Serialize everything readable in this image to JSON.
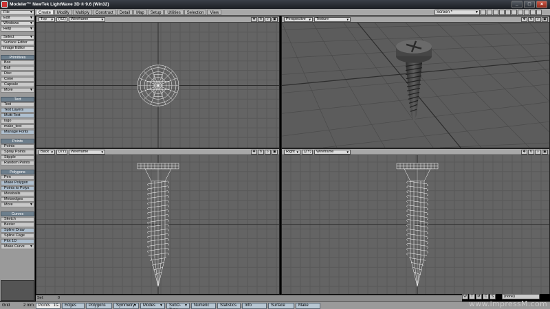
{
  "window": {
    "title": "Modeler™ NewTek LightWave 3D ® 9.6  (Win32)",
    "buttons": [
      "_",
      "□",
      "×"
    ]
  },
  "tabs": [
    "Create",
    "Modify",
    "Multiply",
    "Construct",
    "Detail",
    "Map",
    "Setup",
    "Utilities",
    "Selection",
    "View"
  ],
  "active_tab": "Create",
  "screen_select": "Screen *",
  "sidebar": {
    "menus": [
      "File",
      "Edit",
      "Windows",
      "Help",
      "Select",
      "Surface Editor",
      "Image Editor"
    ],
    "sections": [
      {
        "header": "Primitives",
        "items": [
          "Box",
          "Ball",
          "Disc",
          "Cone",
          "Capsule",
          "More"
        ]
      },
      {
        "header": "Text",
        "items": [
          "Text",
          "Text Layers",
          "Multi-Text",
          "logo",
          "make_text",
          "Manage Fonts"
        ]
      },
      {
        "header": "Points",
        "items": [
          "Points",
          "Spray Points",
          "Stipple",
          "Random Points"
        ]
      },
      {
        "header": "Polygons",
        "items": [
          "Pen",
          "Make Polygon",
          "Points to Polys",
          "Metaballs",
          "Metaedges",
          "More"
        ]
      },
      {
        "header": "Curves",
        "items": [
          "Sketch",
          "Bezier",
          "Spline Draw",
          "Spline Cage",
          "Plot 1D",
          "Make Curve"
        ]
      }
    ]
  },
  "viewports": {
    "top_left": {
      "view": "Top",
      "axis": "(XZ)",
      "mode": "Wireframe"
    },
    "top_right": {
      "view": "Perspective",
      "mode": "Texture"
    },
    "bottom_left": {
      "view": "Back",
      "axis": "(XY)",
      "mode": "Wireframe"
    },
    "bottom_right": {
      "view": "Right",
      "axis": "(ZY)",
      "mode": "Wireframe"
    }
  },
  "grid_status": {
    "sel_label": "Sel:",
    "sel_value": "0"
  },
  "bottombar": {
    "grid_label": "Grid",
    "grid_value": "2 mm",
    "buttons": [
      "Points",
      "Edges",
      "Polygons",
      "Symmetry",
      "Modes",
      "SubD-Type",
      "Numeric",
      "Statistics",
      "Info",
      "Surface",
      "Make"
    ],
    "points_count": "1G"
  },
  "status_tiles": [
    "W",
    "T",
    "M",
    "C",
    "S"
  ],
  "status_select": "(none)",
  "watermark": "www.impressM.com",
  "colors": {
    "viewport_bg": "#646464",
    "grid_line": "#585858",
    "axis_line": "#3a3a3a",
    "sidebar_header": "#6d7f8d",
    "tool_blue": "#aebfcf"
  }
}
